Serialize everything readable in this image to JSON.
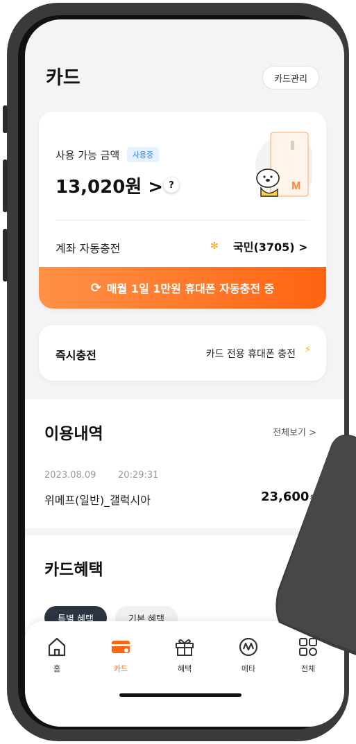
{
  "header": {
    "title": "카드",
    "manage_label": "카드관리"
  },
  "card": {
    "available_label": "사용 가능 금액",
    "status_badge": "사용중",
    "balance": "13,020원 >",
    "help_symbol": "?",
    "auto_charge_label": "계좌 자동충전",
    "bank": "국민(3705) >",
    "banner_text": "매월 1일 1만원 휴대폰 자동충전 중"
  },
  "instant": {
    "label": "즉시충전",
    "right_text": "카드 전용 휴대폰 충전"
  },
  "history": {
    "title": "이용내역",
    "see_all": "전체보기 >",
    "date": "2023.08.09",
    "time": "20:29:31",
    "merchant": "위메프(일반)_갤럭시아",
    "amount": "23,600",
    "unit": "원"
  },
  "benefits": {
    "title": "카드혜택",
    "chip1": "특별 혜택",
    "chip2": "기본 혜택"
  },
  "nav": {
    "items": [
      {
        "label": "홈",
        "icon": "home-icon"
      },
      {
        "label": "카드",
        "icon": "card-icon"
      },
      {
        "label": "혜택",
        "icon": "gift-icon"
      },
      {
        "label": "메타",
        "icon": "meta-icon"
      },
      {
        "label": "전체",
        "icon": "grid-icon"
      }
    ],
    "active_color": "#ff6411"
  },
  "colors": {
    "accent": "#ff6411",
    "badge_blue": "#2a8cf0"
  }
}
